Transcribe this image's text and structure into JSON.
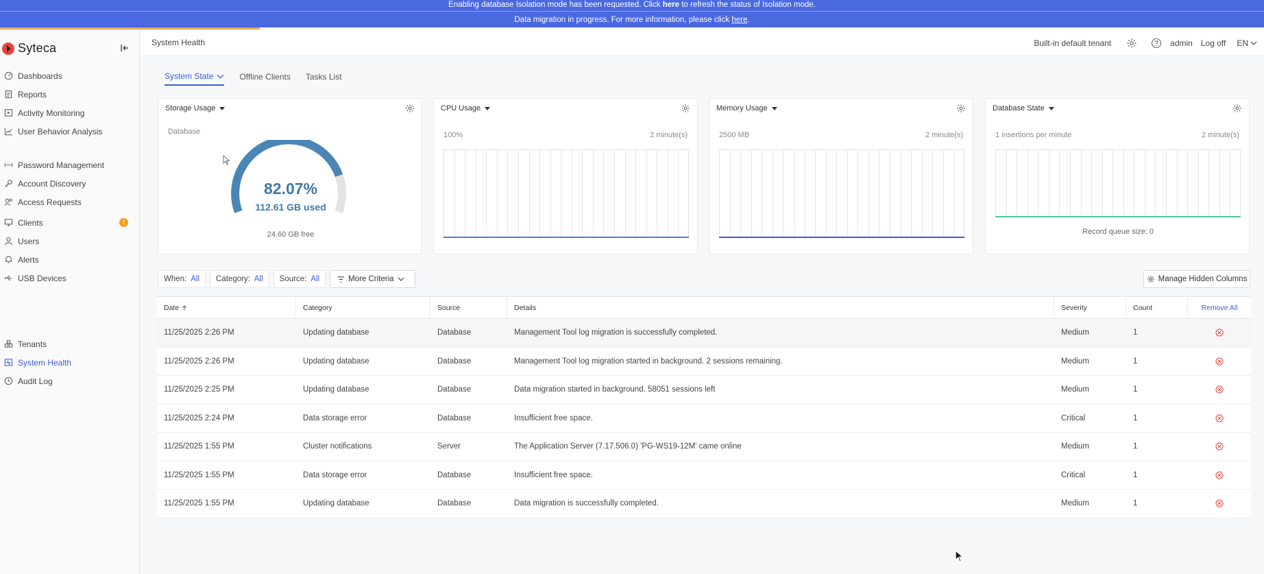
{
  "banners": {
    "isolation": {
      "pre": "Enabling database Isolation mode has been requested. Click ",
      "link": "here",
      "post": " to refresh the status of Isolation mode."
    },
    "migration": {
      "pre": "Data migration in progress. For more information, please click ",
      "link": "here",
      "post": "."
    }
  },
  "brand": {
    "name": "Syteca",
    "accent": "#3b5bd6",
    "logo_color": "#e8423a"
  },
  "sidebar": {
    "items": [
      {
        "id": "dashboards",
        "label": "Dashboards",
        "icon": "dashboard-icon"
      },
      {
        "id": "reports",
        "label": "Reports",
        "icon": "reports-icon"
      },
      {
        "id": "activity-monitoring",
        "label": "Activity Monitoring",
        "icon": "play-icon"
      },
      {
        "id": "user-behavior-analysis",
        "label": "User Behavior Analysis",
        "icon": "chart-icon"
      },
      {
        "id": "password-management",
        "label": "Password Management",
        "icon": "password-icon"
      },
      {
        "id": "account-discovery",
        "label": "Account Discovery",
        "icon": "key-icon"
      },
      {
        "id": "access-requests",
        "label": "Access Requests",
        "icon": "access-icon"
      },
      {
        "id": "clients",
        "label": "Clients",
        "icon": "monitor-icon",
        "badge": "!"
      },
      {
        "id": "users",
        "label": "Users",
        "icon": "user-icon"
      },
      {
        "id": "alerts",
        "label": "Alerts",
        "icon": "bell-icon"
      },
      {
        "id": "usb-devices",
        "label": "USB Devices",
        "icon": "usb-icon"
      },
      {
        "id": "tenants",
        "label": "Tenants",
        "icon": "tenants-icon"
      },
      {
        "id": "system-health",
        "label": "System Health",
        "icon": "health-icon",
        "active": true
      },
      {
        "id": "audit-log",
        "label": "Audit Log",
        "icon": "clock-icon"
      }
    ]
  },
  "header": {
    "title": "System Health",
    "tenant": "Built-in default tenant",
    "user": "admin",
    "logoff": "Log off",
    "language": "EN"
  },
  "tabs": [
    {
      "label": "System State",
      "active": true
    },
    {
      "label": "Offline Clients"
    },
    {
      "label": "Tasks List"
    }
  ],
  "widgets": {
    "storage": {
      "title": "Storage Usage",
      "subtitle": "Database",
      "percent_text": "82.07%",
      "percent": 82.07,
      "used": "112.61 GB used",
      "free": "24.60 GB free",
      "color": "#4a86b5"
    },
    "cpu": {
      "title": "CPU Usage",
      "left": "100%",
      "right": "2 minute(s)",
      "line_color": "#4a7fc0"
    },
    "memory": {
      "title": "Memory Usage",
      "left": "2500 MB",
      "right": "2 minute(s)",
      "line_color": "#3b5bd6"
    },
    "database": {
      "title": "Database State",
      "left": "1 insertions per minute",
      "right": "2 minute(s)",
      "queue": "Record queue size: 0",
      "line_color": "#4cc6a0"
    }
  },
  "filters": {
    "when": {
      "label": "When:",
      "value": "All"
    },
    "category": {
      "label": "Category:",
      "value": "All"
    },
    "source": {
      "label": "Source:",
      "value": "All"
    },
    "more": "More Criteria",
    "manage_hidden": "Manage Hidden Columns"
  },
  "table": {
    "columns": {
      "date": "Date",
      "category": "Category",
      "source": "Source",
      "details": "Details",
      "severity": "Severity",
      "count": "Count",
      "remove_all": "Remove All"
    },
    "rows": [
      {
        "date": "11/25/2025 2:26 PM",
        "category": "Updating database",
        "source": "Database",
        "details": "Management Tool log migration is successfully completed.",
        "severity": "Medium",
        "count": "1"
      },
      {
        "date": "11/25/2025 2:26 PM",
        "category": "Updating database",
        "source": "Database",
        "details": "Management Tool log migration started in background. 2 sessions remaining.",
        "severity": "Medium",
        "count": "1"
      },
      {
        "date": "11/25/2025 2:25 PM",
        "category": "Updating database",
        "source": "Database",
        "details": "Data migration started in background. 58051 sessions left",
        "severity": "Medium",
        "count": "1"
      },
      {
        "date": "11/25/2025 2:24 PM",
        "category": "Data storage error",
        "source": "Database",
        "details": "Insufficient free space.",
        "severity": "Critical",
        "count": "1"
      },
      {
        "date": "11/25/2025 1:55 PM",
        "category": "Cluster notifications",
        "source": "Server",
        "details": "The Application Server (7.17.506.0) 'PG-WS19-12M' came online",
        "severity": "Medium",
        "count": "1"
      },
      {
        "date": "11/25/2025 1:55 PM",
        "category": "Data storage error",
        "source": "Database",
        "details": "Insufficient free space.",
        "severity": "Critical",
        "count": "1"
      },
      {
        "date": "11/25/2025 1:55 PM",
        "category": "Updating database",
        "source": "Database",
        "details": "Data migration is successfully completed.",
        "severity": "Medium",
        "count": "1"
      }
    ]
  }
}
